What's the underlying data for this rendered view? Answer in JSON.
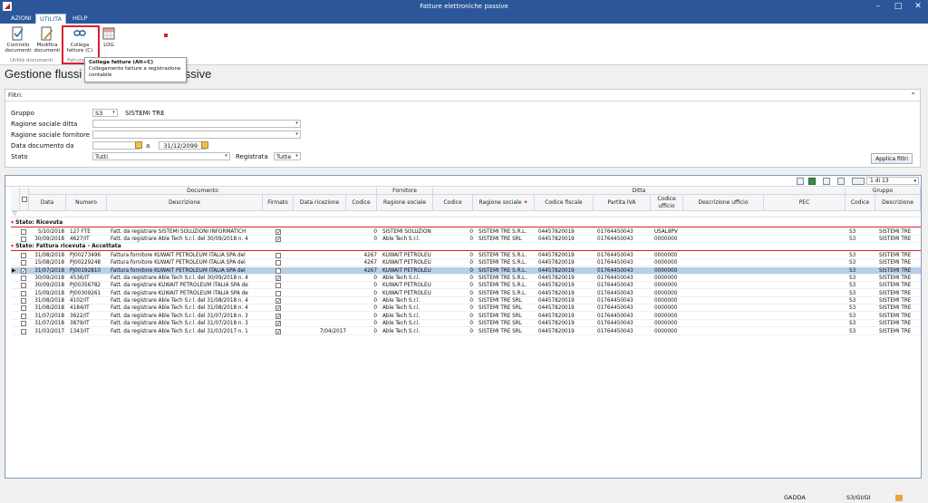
{
  "window": {
    "title": "Fatture elettroniche passive",
    "icon": "app-logo-icon"
  },
  "tabs": [
    {
      "label": "AZIONI"
    },
    {
      "label": "UTILITÀ"
    },
    {
      "label": "HELP"
    }
  ],
  "ribbon": {
    "controllo": "Controllo documenti",
    "modifica": "Modifica documenti",
    "collega": "Collega fatture (C)",
    "log": "LOG",
    "group1": "Utilità documenti",
    "group2": "Fatture"
  },
  "tooltip": {
    "title": "Collega fatture (Alt+C)",
    "body": "Collegamento fatture a registrazione contabile"
  },
  "page_title": "Gestione flussi fa",
  "page_title_tail": "ssive",
  "filters": {
    "header": "Filtri:",
    "gruppo_label": "Gruppo",
    "gruppo_code": "S3",
    "gruppo_name": "SISTEMI TRE",
    "ditta_label": "Ragione sociale ditta",
    "fornitore_label": "Ragione sociale fornitore",
    "data_label": "Data documento da",
    "a_label": "a",
    "data_a": "31/12/2099",
    "stato_label": "Stato",
    "stato_value": "Tutti",
    "registrata_label": "Registrata",
    "registrata_value": "Tutte",
    "apply": "Applica filtri"
  },
  "grid": {
    "pager": "1 di 13",
    "groups": {
      "documento": "Documento",
      "fornitore": "Fornitore",
      "ditta": "Ditta",
      "gruppo": "Gruppo"
    },
    "columns": {
      "data": "Data",
      "numero": "Numero",
      "descrizione": "Descrizione",
      "firmato": "Firmato",
      "ricezione": "Data ricezione",
      "codice": "Codice",
      "ragione": "Ragione sociale",
      "codice2": "Codice",
      "ragione2": "Ragione sociale",
      "fiscale": "Codice fiscale",
      "iva": "Partita IVA",
      "uff_code": "Codice ufficio",
      "uff_desc": "Descrizione ufficio",
      "pec": "PEC",
      "g_codice": "Codice",
      "g_desc": "Descrizione"
    },
    "group1": "Stato: Ricevuta",
    "group2": "Stato: Fattura ricevuta - Accettata",
    "rows1": [
      {
        "data": "5/10/2018",
        "numero": "127 FTE",
        "desc": "Fatt. da registrare SISTEMI SOLUZIONI INFORMATICH",
        "firmato": true,
        "ricezione": "",
        "codice": "0",
        "ragione": "SISTEMI SOLUZION",
        "codice2": "0",
        "ragione2": "SISTEMI TRE S.R.L.",
        "fiscale": "04457820019",
        "iva": "01764450043",
        "uff": "USAL8PV",
        "g_codice": "S3",
        "g_desc": "SISTEMI TRE"
      },
      {
        "data": "30/09/2018",
        "numero": "4627/IT",
        "desc": "Fatt. da registrare Able Tech S.r.l. del 30/09/2018 n. 4",
        "firmato": true,
        "ricezione": "",
        "codice": "0",
        "ragione": "Able Tech S.r.l.",
        "codice2": "0",
        "ragione2": "SISTEMI TRE SRL",
        "fiscale": "04457820019",
        "iva": "01764450043",
        "uff": "0000000",
        "g_codice": "S3",
        "g_desc": "SISTEMI TRE"
      }
    ],
    "rows2": [
      {
        "data": "31/08/2018",
        "numero": "PJ00273496",
        "desc": "Fattura fornitore KUWAIT PETROLEUM ITALIA SPA del",
        "firmato": false,
        "ricezione": "",
        "codice": "4267",
        "ragione": "KUWAIT PETROLEU",
        "codice2": "0",
        "ragione2": "SISTEMI TRE S.R.L.",
        "fiscale": "04457820019",
        "iva": "01764450043",
        "uff": "0000000",
        "g_codice": "S3",
        "g_desc": "SISTEMI TRE"
      },
      {
        "data": "15/08/2018",
        "numero": "PJ00229248",
        "desc": "Fattura fornitore KUWAIT PETROLEUM ITALIA SPA del",
        "firmato": false,
        "ricezione": "",
        "codice": "4267",
        "ragione": "KUWAIT PETROLEU",
        "codice2": "0",
        "ragione2": "SISTEMI TRE S.R.L.",
        "fiscale": "04457820019",
        "iva": "01764450043",
        "uff": "0000000",
        "g_codice": "S3",
        "g_desc": "SISTEMI TRE"
      },
      {
        "data": "31/07/2018",
        "numero": "PJ00192810",
        "desc": "Fattura fornitore KUWAIT PETROLEUM ITALIA SPA del",
        "firmato": false,
        "ricezione": "",
        "codice": "4267",
        "ragione": "KUWAIT PETROLEU",
        "codice2": "0",
        "ragione2": "SISTEMI TRE S.R.L.",
        "fiscale": "04457820019",
        "iva": "01764450043",
        "uff": "0000000",
        "g_codice": "S3",
        "g_desc": "SISTEMI TRE",
        "selected": true
      },
      {
        "data": "30/09/2018",
        "numero": "4536/IT",
        "desc": "Fatt. da registrare Able Tech S.r.l. del 30/09/2018 n. 4",
        "firmato": true,
        "ricezione": "",
        "codice": "0",
        "ragione": "Able Tech S.r.l.",
        "codice2": "0",
        "ragione2": "SISTEMI TRE S.R.L.",
        "fiscale": "04457820019",
        "iva": "01764450043",
        "uff": "0000000",
        "g_codice": "S3",
        "g_desc": "SISTEMI TRE"
      },
      {
        "data": "30/09/2018",
        "numero": "PJ00356782",
        "desc": "Fatt. da registrare KUWAIT PETROLEUM ITALIA SPA de",
        "firmato": false,
        "ricezione": "",
        "codice": "0",
        "ragione": "KUWAIT PETROLEU",
        "codice2": "0",
        "ragione2": "SISTEMI TRE S.R.L.",
        "fiscale": "04457820019",
        "iva": "01764450043",
        "uff": "0000000",
        "g_codice": "S3",
        "g_desc": "SISTEMI TRE"
      },
      {
        "data": "15/09/2018",
        "numero": "PJ00309261",
        "desc": "Fatt. da registrare KUWAIT PETROLEUM ITALIA SPA de",
        "firmato": false,
        "ricezione": "",
        "codice": "0",
        "ragione": "KUWAIT PETROLEU",
        "codice2": "0",
        "ragione2": "SISTEMI TRE S.R.L.",
        "fiscale": "04457820019",
        "iva": "01764450043",
        "uff": "0000000",
        "g_codice": "S3",
        "g_desc": "SISTEMI TRE"
      },
      {
        "data": "31/08/2018",
        "numero": "4102/IT",
        "desc": "Fatt. da registrare Able Tech S.r.l. del 31/08/2018 n. 4",
        "firmato": true,
        "ricezione": "",
        "codice": "0",
        "ragione": "Able Tech S.r.l.",
        "codice2": "0",
        "ragione2": "SISTEMI TRE SRL",
        "fiscale": "04457820019",
        "iva": "01764450043",
        "uff": "0000000",
        "g_codice": "S3",
        "g_desc": "SISTEMI TRE"
      },
      {
        "data": "31/08/2018",
        "numero": "4184/IT",
        "desc": "Fatt. da registrare Able Tech S.r.l. del 31/08/2018 n. 4",
        "firmato": true,
        "ricezione": "",
        "codice": "0",
        "ragione": "Able Tech S.r.l.",
        "codice2": "0",
        "ragione2": "SISTEMI TRE SRL",
        "fiscale": "04457820019",
        "iva": "01764450043",
        "uff": "0000000",
        "g_codice": "S3",
        "g_desc": "SISTEMI TRE"
      },
      {
        "data": "31/07/2018",
        "numero": "3622/IT",
        "desc": "Fatt. da registrare Able Tech S.r.l. del 31/07/2018 n. 3",
        "firmato": true,
        "ricezione": "",
        "codice": "0",
        "ragione": "Able Tech S.r.l.",
        "codice2": "0",
        "ragione2": "SISTEMI TRE SRL",
        "fiscale": "04457820019",
        "iva": "01764450043",
        "uff": "0000000",
        "g_codice": "S3",
        "g_desc": "SISTEMI TRE"
      },
      {
        "data": "31/07/2018",
        "numero": "3879/IT",
        "desc": "Fatt. da registrare Able Tech S.r.l. del 31/07/2018 n. 3",
        "firmato": true,
        "ricezione": "",
        "codice": "0",
        "ragione": "Able Tech S.r.l.",
        "codice2": "0",
        "ragione2": "SISTEMI TRE SRL",
        "fiscale": "04457820019",
        "iva": "01764450043",
        "uff": "0000000",
        "g_codice": "S3",
        "g_desc": "SISTEMI TRE"
      },
      {
        "data": "31/03/2017",
        "numero": "1343/IT",
        "desc": "Fatt. da registrare Able Tech S.r.l. del 31/03/2017 n. 1",
        "firmato": true,
        "ricezione": "7/04/2017",
        "codice": "0",
        "ragione": "Able Tech S.r.l.",
        "codice2": "0",
        "ragione2": "SISTEMI TRE SRL",
        "fiscale": "04457820019",
        "iva": "01764450043",
        "uff": "0000000",
        "g_codice": "S3",
        "g_desc": "SISTEMI TRE"
      }
    ]
  },
  "status": {
    "user": "GADDA",
    "company": "S3/GI/GI"
  },
  "colors": {
    "accent": "#2b579a",
    "selection": "#b8cfe6",
    "highlight": "#d9202e"
  }
}
